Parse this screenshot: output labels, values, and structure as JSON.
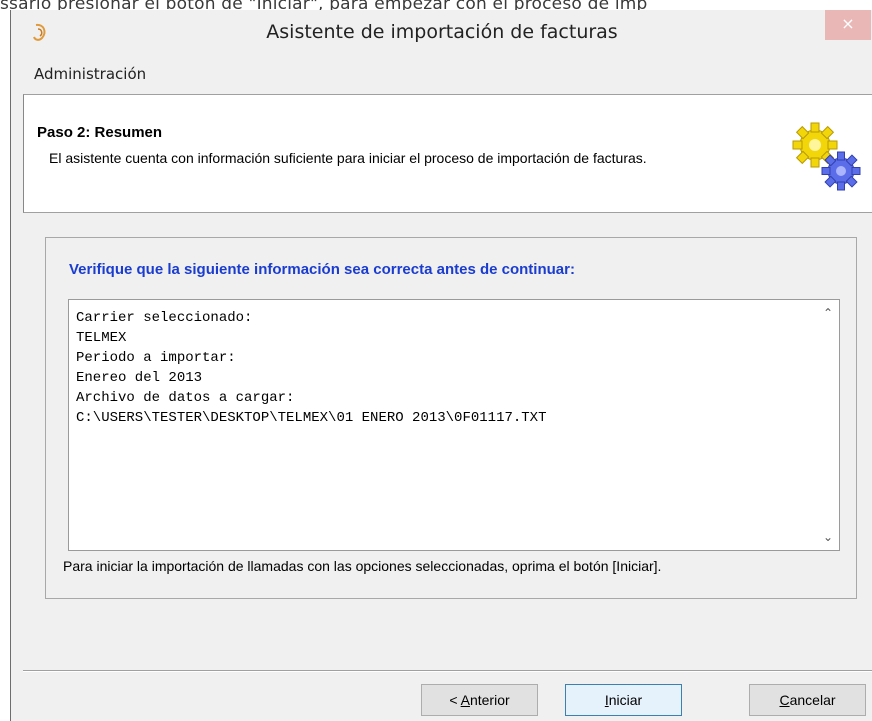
{
  "background_text": "ssario presionar el botón de \"Iniciar\", para empezar con el proceso de imp",
  "window": {
    "title": "Asistente de importación de facturas",
    "close_symbol": "×",
    "icon": "app-logo-icon"
  },
  "menubar": {
    "items": [
      "Administración"
    ]
  },
  "header": {
    "step_title": "Paso 2: Resumen",
    "description": "El asistente cuenta con información suficiente para iniciar el proceso de importación de facturas.",
    "icon": "gears-icon"
  },
  "content": {
    "verify_heading": "Verifique que la siguiente información sea correcta antes de continuar:",
    "summary_lines": [
      "Carrier seleccionado:",
      "TELMEX",
      "Periodo a importar:",
      "Enereo del 2013",
      "Archivo de datos a cargar:",
      "C:\\USERS\\TESTER\\DESKTOP\\TELMEX\\01 ENERO 2013\\0F01117.TXT"
    ],
    "hint": "Para iniciar la importación de llamadas con las opciones seleccionadas, oprima el botón [Iniciar]."
  },
  "buttons": {
    "back": {
      "prefix": "< ",
      "mnemonic": "A",
      "rest": "nterior"
    },
    "start": {
      "mnemonic": "I",
      "rest": "niciar"
    },
    "cancel": {
      "mnemonic": "C",
      "rest": "ancelar"
    }
  },
  "colors": {
    "heading": "#1a3ccf",
    "close_button": "#e9b7b5"
  }
}
